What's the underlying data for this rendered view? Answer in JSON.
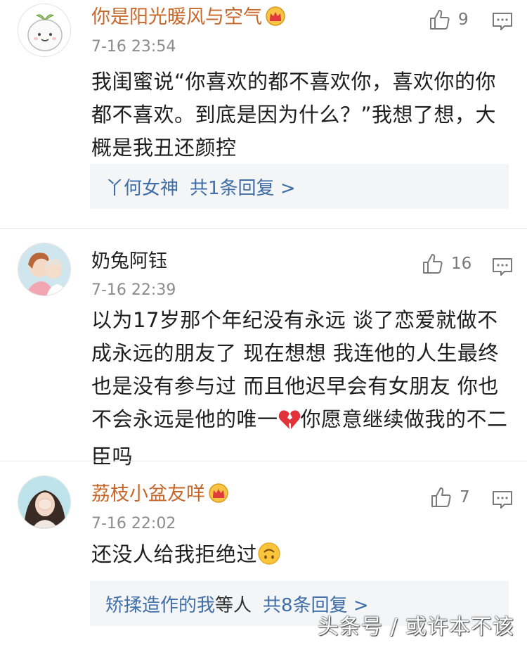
{
  "comments": [
    {
      "username": "你是阳光暖风与空气",
      "vip": true,
      "time": "7-16 23:54",
      "likes": "9",
      "text": "我闺蜜说“你喜欢的都不喜欢你，喜欢你的你都不喜欢。到底是因为什么？”我想了想，大概是我丑还颜控",
      "reply": {
        "users": "丫何女神",
        "suffix": "",
        "count": "共1条回复 >"
      }
    },
    {
      "username": "奶兔阿钰",
      "vip": false,
      "time": "7-16 22:39",
      "likes": "16",
      "text_before": "以为17岁那个年纪没有永远 谈了恋爱就做不成永远的朋友了 现在想想 我连他的人生最终也是没有参与过 而且他迟早会有女朋友 你也不会永远是他的唯一",
      "emoji": "broken-heart",
      "text_after": "你愿意继续做我的不二臣吗"
    },
    {
      "username": "荔枝小盆友咩",
      "vip": true,
      "time": "7-16 22:02",
      "likes": "7",
      "text_before": "还没人给我拒绝过",
      "emoji": "upside-down-face",
      "reply": {
        "users": "矫揉造作的我",
        "suffix": "等人",
        "count": "共8条回复 >"
      }
    }
  ],
  "watermark": "头条号 / 或许本不该",
  "colors": {
    "vip_name": "#c8672a",
    "reply_link": "#3f6ea8",
    "meta": "#8c8c8c"
  }
}
